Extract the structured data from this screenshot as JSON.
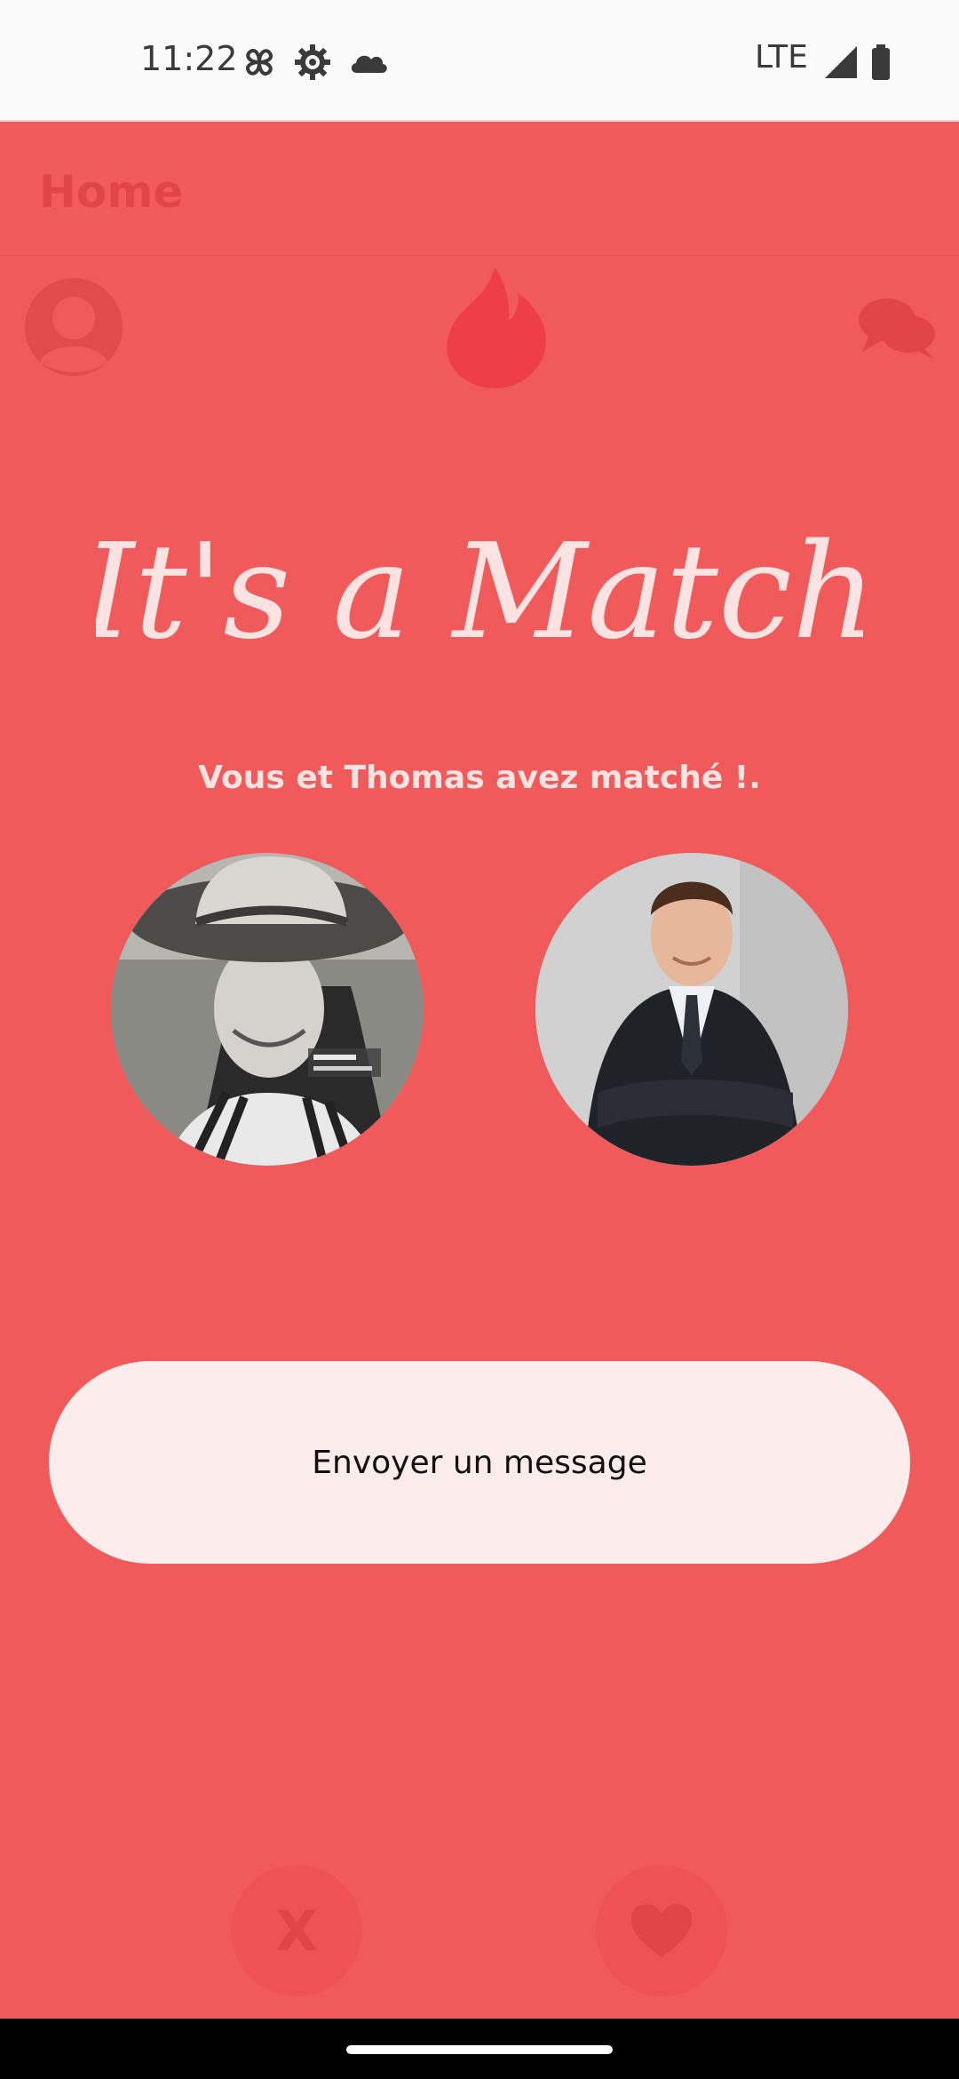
{
  "status_bar": {
    "time": "11:22",
    "network": "LTE",
    "icons": [
      "pinwheel-icon",
      "gear-icon",
      "cloud-icon",
      "signal-icon",
      "battery-icon"
    ]
  },
  "topbar": {
    "title": "Home"
  },
  "nav": {
    "icons": [
      "profile-icon",
      "flame-icon",
      "chat-icon"
    ]
  },
  "match": {
    "title": "It's a Match",
    "subtitle": "Vous et Thomas avez matché !."
  },
  "actions": {
    "send_message_label": "Envoyer un message",
    "reject_label": "X",
    "like_icon": "heart-icon"
  },
  "colors": {
    "background": "#f15a5b",
    "button": "#fdecec",
    "title_script": "#fde2e2"
  }
}
